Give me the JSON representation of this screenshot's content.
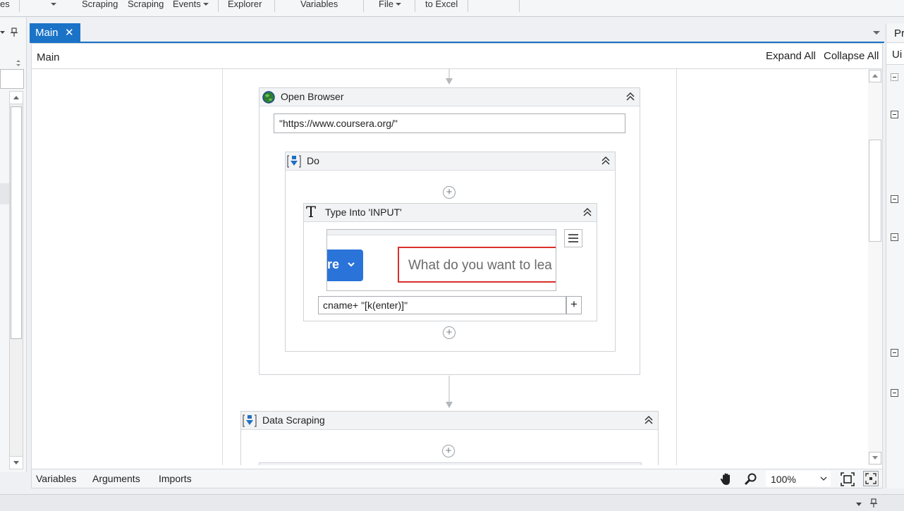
{
  "ribbon": {
    "items": [
      {
        "label": "es"
      },
      {
        "label": "Scraping"
      },
      {
        "label": "Scraping"
      },
      {
        "label": "Events"
      },
      {
        "label": "Explorer"
      },
      {
        "label": "Variables"
      },
      {
        "label": "File"
      },
      {
        "label": "to Excel"
      }
    ]
  },
  "tabs": {
    "main_label": "Main",
    "close_glyph": "✕"
  },
  "designer": {
    "breadcrumb": "Main",
    "expand_all": "Expand All",
    "collapse_all": "Collapse All"
  },
  "activities": {
    "open_browser": {
      "title": "Open Browser",
      "url": "\"https://www.coursera.org/\""
    },
    "do": {
      "title": "Do"
    },
    "type_into": {
      "title": "Type Into 'INPUT'",
      "preview_button_text": "re",
      "preview_input_placeholder": "What do you want to lea",
      "text_value": "cname+ \"[k(enter)]\"",
      "add_label": "+"
    },
    "data_scraping": {
      "title": "Data Scraping"
    }
  },
  "status_bar": {
    "variables": "Variables",
    "arguments": "Arguments",
    "imports": "Imports",
    "zoom": "100%"
  },
  "right_panel": {
    "tab_label": "Pr",
    "header_label": "Ui"
  },
  "colors": {
    "accent": "#1a73c7",
    "preview_button": "#2a73d9",
    "highlight_border": "#d9302b"
  }
}
